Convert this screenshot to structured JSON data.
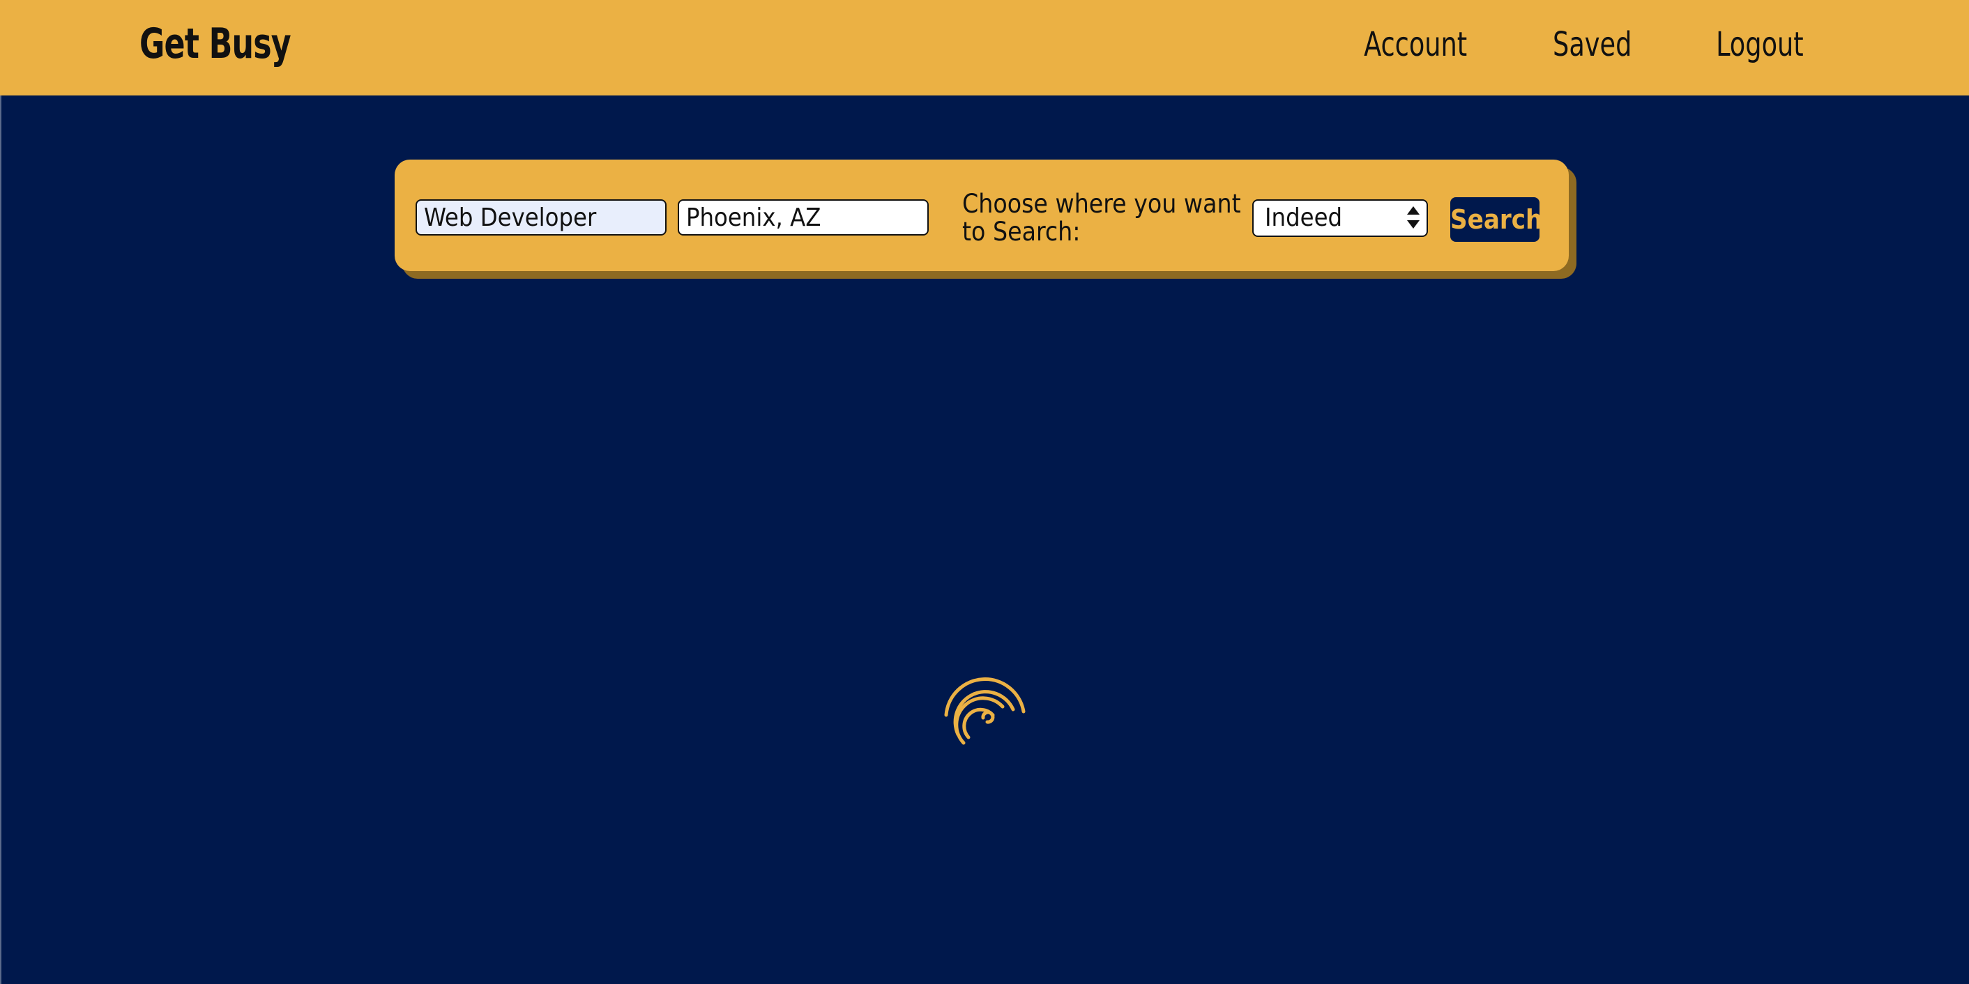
{
  "navbar": {
    "brand": "Get Busy",
    "links": [
      {
        "label": "Account"
      },
      {
        "label": "Saved"
      },
      {
        "label": "Logout"
      }
    ]
  },
  "search": {
    "job_value": "Web Developer",
    "location_value": "Phoenix, AZ",
    "choose_label": "Choose where you want to Search:",
    "site_selected": "Indeed",
    "button_label": "Search"
  },
  "loading": {
    "icon": "loading-spinner-icon"
  },
  "colors": {
    "accent": "#ebb144",
    "background": "#00184c",
    "panel_shadow": "#8e6a22"
  }
}
